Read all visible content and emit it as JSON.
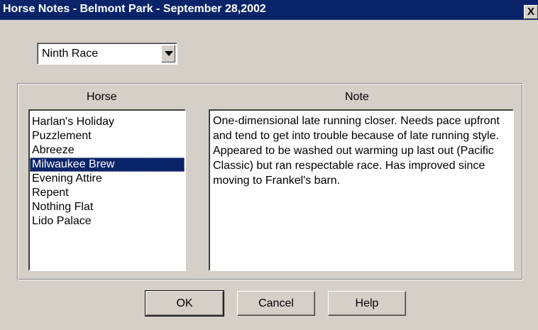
{
  "window": {
    "title": "Horse Notes - Belmont Park - September 28,2002",
    "close_label": "X"
  },
  "race_select": {
    "value": "Ninth Race"
  },
  "columns": {
    "horse": "Horse",
    "note": "Note"
  },
  "horses": [
    "Harlan's Holiday",
    "Puzzlement",
    "Abreeze",
    "Milwaukee Brew",
    "Evening Attire",
    "Repent",
    "Nothing Flat",
    "Lido Palace"
  ],
  "selected_horse": "Milwaukee Brew",
  "note": {
    "text": "One-dimensional late running closer. Needs pace upfront and tend to get into trouble because of late running style. Appeared to be washed out warming up last out (Pacific Classic) but ran respectable race. Has improved since moving to Frankel's barn."
  },
  "buttons": {
    "ok": "OK",
    "cancel": "Cancel",
    "help": "Help"
  },
  "colors": {
    "title_bar": "#0a246a",
    "dialog_bg": "#d4d0c8",
    "selection": "#0a246a"
  }
}
